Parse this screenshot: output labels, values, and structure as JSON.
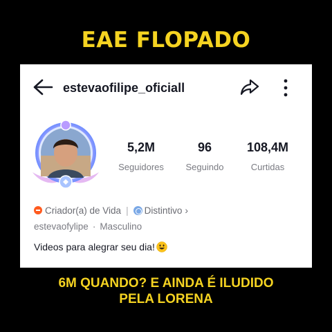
{
  "caption": {
    "top": "EAE FLOPADO",
    "bottom_line1": "6M QUANDO? E AINDA É ILUDIDO",
    "bottom_line2": "PELA LORENA"
  },
  "profile": {
    "username": "estevaofilipe_oficiall",
    "handle": "estevaofylipe",
    "gender": "Masculino",
    "category": "Criador(a) de Vida",
    "badge": "Distintivo",
    "bio": "Videos para alegrar seu dia!"
  },
  "stats": [
    {
      "value": "5,2M",
      "label": "Seguidores"
    },
    {
      "value": "96",
      "label": "Seguindo"
    },
    {
      "value": "108,4M",
      "label": "Curtidas"
    }
  ],
  "colors": {
    "caption": "#f5d321",
    "category_icon": "#ff5b1f",
    "badge_icon": "#7aa8e6"
  },
  "icons": [
    "back-arrow-icon",
    "share-icon",
    "more-icon",
    "smile-emoji-icon"
  ]
}
